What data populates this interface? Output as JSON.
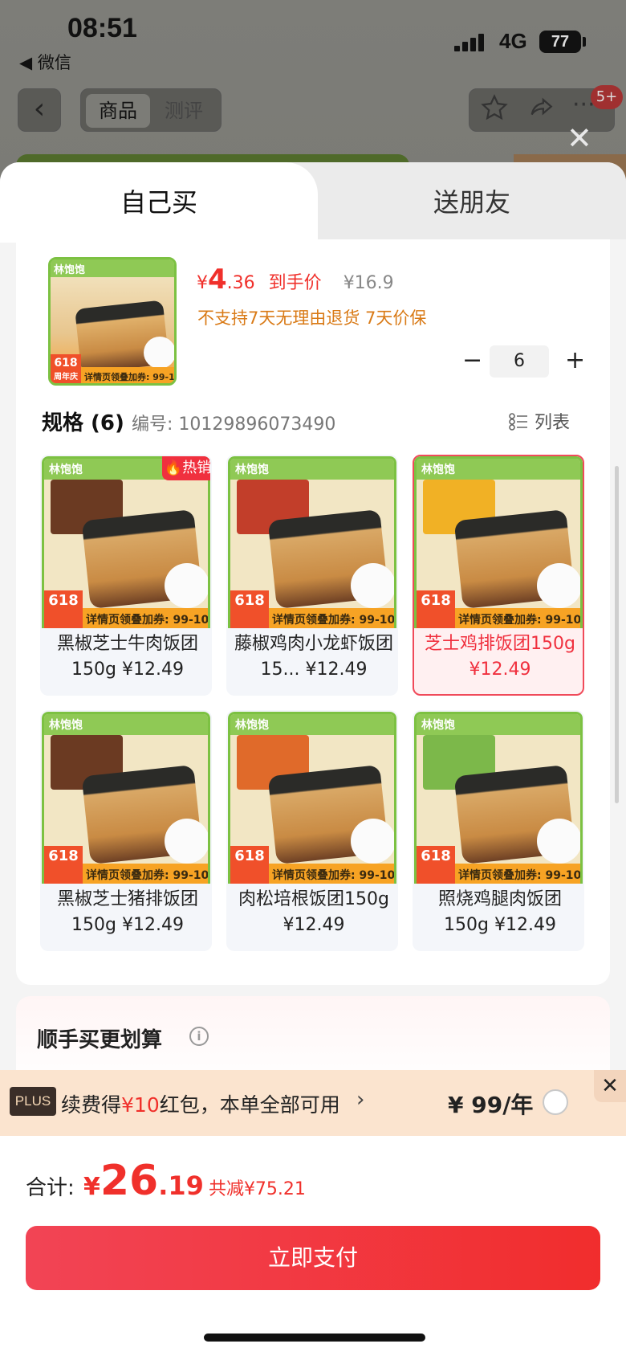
{
  "status": {
    "time": "08:51",
    "back_app": "◀ 微信",
    "network": "4G",
    "battery": "77"
  },
  "nav": {
    "back_icon": "‹",
    "tab_product": "商品",
    "tab_review": "测评",
    "badge": "5+",
    "close": "✕"
  },
  "sheet_tabs": {
    "self": "自己买",
    "friend": "送朋友"
  },
  "product": {
    "currency": "¥",
    "price_int": "4",
    "price_dec": ".36",
    "price_label": "到手价",
    "orig_price": "¥16.9",
    "policy": "不支持7天无理由退货  7天价保",
    "quantity": "6",
    "minus": "−",
    "plus": "+"
  },
  "spec": {
    "title": "规格 (6)",
    "code_label": "编号: 10129896073490",
    "list_label": "列表"
  },
  "thumb_card": {
    "brand": "林饱饱",
    "badge_618": "618",
    "badge_sub": "周年庆",
    "coupon": "详情页领叠加券: 99-10"
  },
  "variants": [
    {
      "name": "黑椒芝士牛肉饭团150g ¥12.49",
      "hot": "热销",
      "band_color": "#6b3a22"
    },
    {
      "name": "藤椒鸡肉小龙虾饭团15... ¥12.49",
      "hot": "",
      "band_color": "#c23e2a"
    },
    {
      "name": "芝士鸡排饭团150g ¥12.49",
      "hot": "",
      "band_color": "#f1b125"
    },
    {
      "name": "黑椒芝士猪排饭团150g ¥12.49",
      "hot": "",
      "band_color": "#6b3a22"
    },
    {
      "name": "肉松培根饭团150g ¥12.49",
      "hot": "",
      "band_color": "#e06a2a"
    },
    {
      "name": "照烧鸡腿肉饭团150g ¥12.49",
      "hot": "",
      "band_color": "#7cb84a"
    }
  ],
  "combo": {
    "title": "顺手买更划算",
    "info": "i"
  },
  "plus_bar": {
    "tag": "PLUS",
    "text_a": "续费得",
    "text_red": "¥10",
    "text_b": "红包，本单全部可用",
    "arrow": "›",
    "price": "¥ 99/年",
    "close": "✕"
  },
  "footer": {
    "total_label": "合计:",
    "yen": "¥",
    "total_int": "26",
    "total_dec": ".19",
    "savings": "共减¥75.21",
    "pay_label": "立即支付"
  },
  "colors": {
    "accent": "#f0302b",
    "plus_bg": "#fbe4cf",
    "green_border": "#7cc142"
  }
}
